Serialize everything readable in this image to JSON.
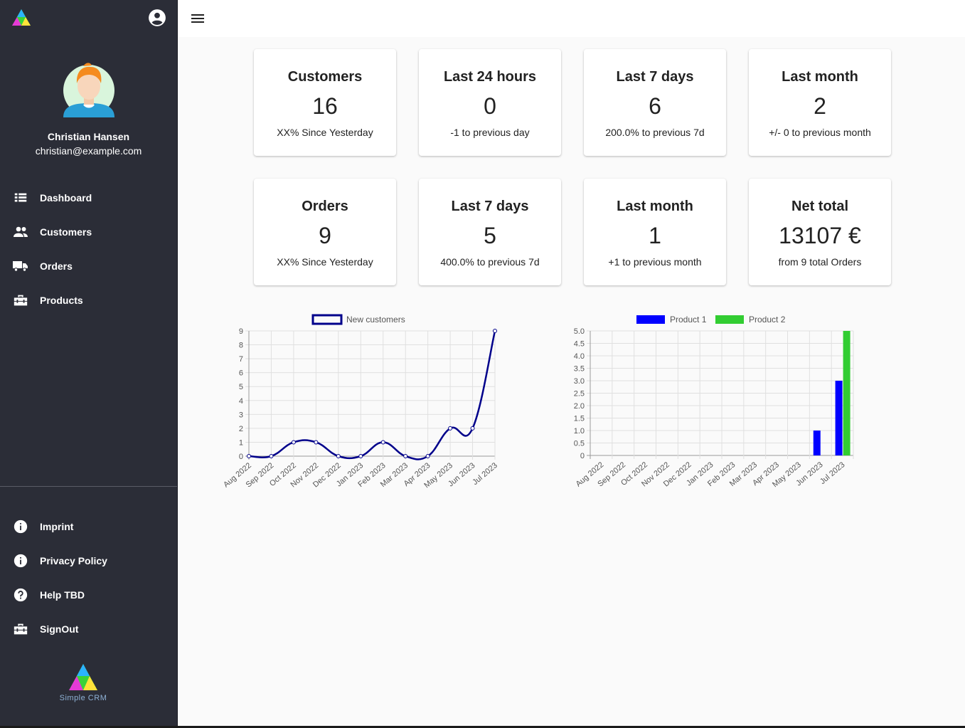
{
  "sidebar": {
    "user": {
      "name": "Christian Hansen",
      "email": "christian@example.com"
    },
    "nav": [
      {
        "label": "Dashboard",
        "icon": "dashboard-icon"
      },
      {
        "label": "Customers",
        "icon": "people-icon"
      },
      {
        "label": "Orders",
        "icon": "truck-icon"
      },
      {
        "label": "Products",
        "icon": "toolbox-icon"
      }
    ],
    "footer_nav": [
      {
        "label": "Imprint",
        "icon": "info-icon"
      },
      {
        "label": "Privacy Policy",
        "icon": "info-icon"
      },
      {
        "label": "Help TBD",
        "icon": "help-icon"
      },
      {
        "label": "SignOut",
        "icon": "toolbox-icon"
      }
    ],
    "brand": "Simple CRM"
  },
  "header": {
    "menu_icon": "menu-icon",
    "account_icon": "account-circle-icon"
  },
  "cards": [
    {
      "title": "Customers",
      "value": "16",
      "sub": "XX% Since Yesterday"
    },
    {
      "title": "Last 24 hours",
      "value": "0",
      "sub": "-1 to previous day"
    },
    {
      "title": "Last 7 days",
      "value": "6",
      "sub": "200.0% to previous 7d"
    },
    {
      "title": "Last month",
      "value": "2",
      "sub": "+/- 0 to previous month"
    },
    {
      "title": "Orders",
      "value": "9",
      "sub": "XX% Since Yesterday"
    },
    {
      "title": "Last 7 days",
      "value": "5",
      "sub": "400.0% to previous 7d"
    },
    {
      "title": "Last month",
      "value": "1",
      "sub": "+1 to previous month"
    },
    {
      "title": "Net total",
      "value": "13107 €",
      "sub": "from 9 total Orders"
    }
  ],
  "chart_data": [
    {
      "type": "line",
      "categories": [
        "Aug 2022",
        "Sep 2022",
        "Oct 2022",
        "Nov 2022",
        "Dec 2022",
        "Jan 2023",
        "Feb 2023",
        "Mar 2023",
        "Apr 2023",
        "May 2023",
        "Jun 2023",
        "Jul 2023"
      ],
      "series": [
        {
          "name": "New customers",
          "values": [
            0,
            0,
            1,
            1,
            0,
            0,
            1,
            0,
            0,
            2,
            2,
            9
          ],
          "color": "#00008b"
        }
      ],
      "ylim": [
        0,
        9
      ],
      "yticks": [
        "0",
        "1",
        "2",
        "3",
        "4",
        "5",
        "6",
        "7",
        "8",
        "9"
      ],
      "grid": true,
      "legend": "top"
    },
    {
      "type": "bar",
      "categories": [
        "Aug 2022",
        "Sep 2022",
        "Oct 2022",
        "Nov 2022",
        "Dec 2022",
        "Jan 2023",
        "Feb 2023",
        "Mar 2023",
        "Apr 2023",
        "May 2023",
        "Jun 2023",
        "Jul 2023"
      ],
      "series": [
        {
          "name": "Product 1",
          "values": [
            0,
            0,
            0,
            0,
            0,
            0,
            0,
            0,
            0,
            0,
            1,
            3
          ],
          "color": "#0000ff"
        },
        {
          "name": "Product 2",
          "values": [
            0,
            0,
            0,
            0,
            0,
            0,
            0,
            0,
            0,
            0,
            0,
            5
          ],
          "color": "#32cd32"
        }
      ],
      "ylim": [
        0,
        5
      ],
      "yticks": [
        "0",
        "0.5",
        "1.0",
        "1.5",
        "2.0",
        "2.5",
        "3.0",
        "3.5",
        "4.0",
        "4.5",
        "5.0"
      ],
      "grid": true,
      "legend": "top"
    }
  ]
}
